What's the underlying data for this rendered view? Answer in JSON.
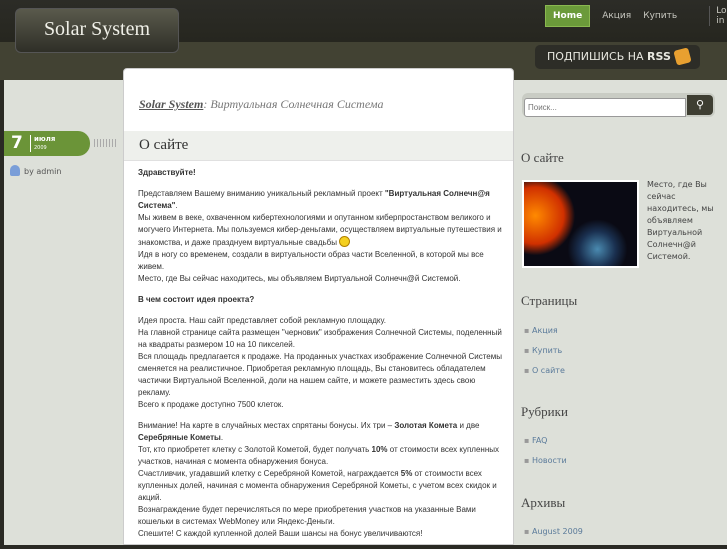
{
  "site": {
    "logo": "Solar System"
  },
  "nav": {
    "items": [
      "Home",
      "Акция",
      "Купить"
    ],
    "login": "Log in"
  },
  "rss": {
    "prefix": "ПОДПИШИСЬ НА",
    "brand": "RSS"
  },
  "breadcrumb": {
    "site": "Solar System",
    "sep": ":",
    "desc": "Виртуальная Солнечная Система"
  },
  "post": {
    "title": "О сайте",
    "date": {
      "day": "7",
      "month": "июля",
      "year": "2009"
    },
    "author": "by admin",
    "greeting": "Здравствуйте!",
    "p1a": "Представляем Вашему вниманию уникальный рекламный проект ",
    "p1b": "\"Виртуальная Солнечн@я Система\"",
    "p1c": ".",
    "p1d": "Мы живем в веке, охваченном кибертехнологиями и опутанном киберпростанством великого и могучего Интернета. Мы пользуемся кибер-деньгами, осуществляем виртуальные путешествия и знакомства, и даже празднуем виртуальные свадьбы",
    "p1e": "Идя в ногу со временем, создали в виртуальности образ части Вселенной, в которой мы все живем.",
    "p1f": "Место, где Вы сейчас находитесь, мы объявляем Виртуальной Солнечн@й Системой.",
    "q": "В чем состоит идея проекта?",
    "p2": [
      "Идея проста. Наш сайт представляет собой рекламную площадку.",
      "На главной странице сайта размещен \"черновик\" изображения Солнечной Системы, поделенный на квадраты размером 10 на 10 пикселей.",
      "Вся площадь предлагается к продаже. На проданных участках изображение Солнечной Системы сменяется на реалистичное. Приобретая рекламную площадь, Вы становитесь обладателем частички Виртуальной Вселенной, доли на нашем сайте, и можете разместить здесь свою рекламу.",
      "Всего к продаже доступно 7500 клеток."
    ],
    "p3a": "Внимание! На карте в случайных местах спрятаны бонусы. Их три – ",
    "p3b": "Золотая Комета",
    "p3c": " и две ",
    "p3d": "Серебряные Кометы",
    "p3e": ".",
    "p3f": "Тот, кто приобретет клетку с Золотой Кометой, будет получать ",
    "p3g": "10%",
    "p3h": " от стоимости всех купленных участков, начиная с момента обнаружения бонуса.",
    "p3i": "Счастливчик, угадавший клетку с Серебряной Кометой, награждается ",
    "p3j": "5%",
    "p3k": " от стоимости всех купленных долей, начиная с момента обнаружения Серебряной Кометы, с учетом всех скидок и акций.",
    "p3l": "Вознаграждение будет перечисляться по мере приобретения участков на указанные Вами кошельки в системах WebMoney или Яндекс-Деньги.",
    "p3m": "Спешите! С каждой купленной долей Ваши шансы на бонус увеличиваются!"
  },
  "sidebar": {
    "search_placeholder": "Поиск...",
    "about_title": "О сайте",
    "about_text": "Место, где Вы сейчас находитесь, мы объявляем Виртуальной Солнечн@й Системой.",
    "pages_title": "Страницы",
    "pages": [
      "Акция",
      "Купить",
      "О сайте"
    ],
    "cats_title": "Рубрики",
    "cats": [
      "FAQ",
      "Новости"
    ],
    "archive_title": "Архивы",
    "archive": [
      "August 2009"
    ]
  }
}
